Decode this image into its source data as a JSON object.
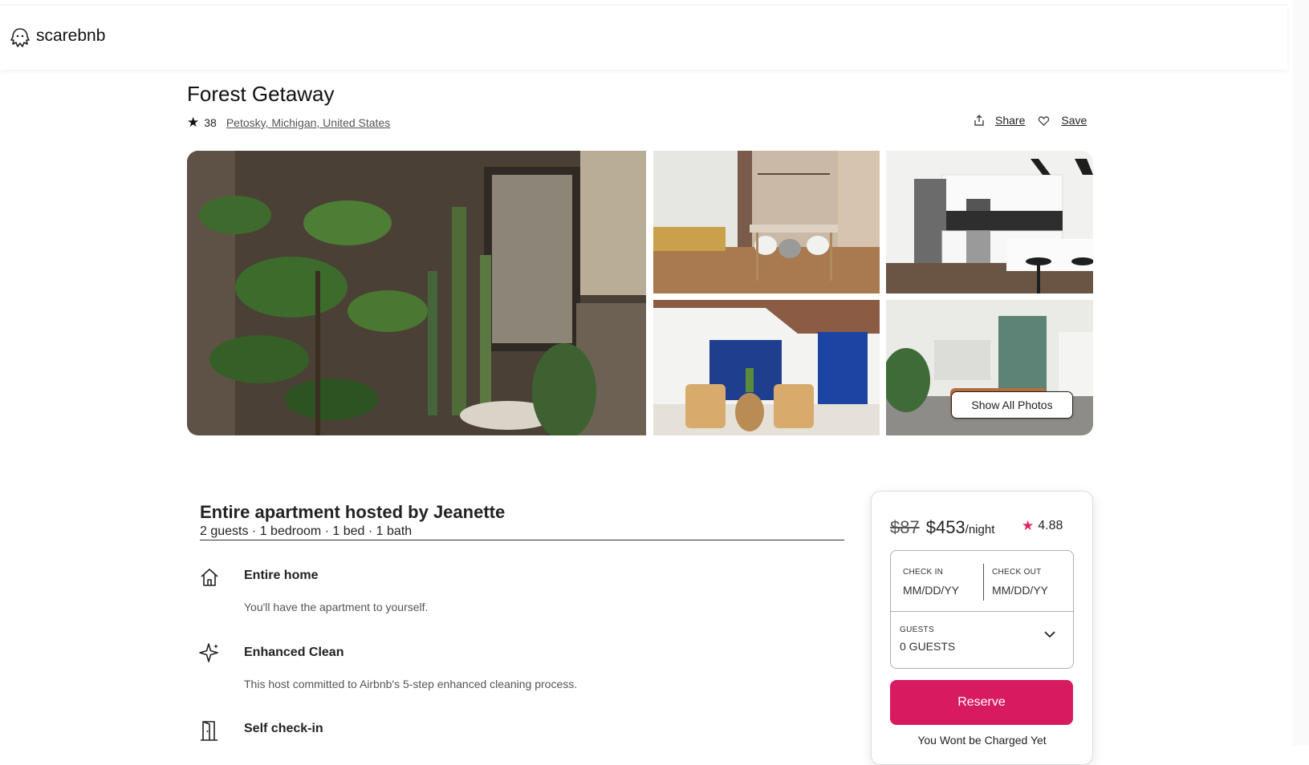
{
  "brand": {
    "name": "scarebnb",
    "icon": "ghost-icon"
  },
  "listing": {
    "title": "Forest Getaway",
    "review_count": "38",
    "location": "Petosky, Michigan, United States"
  },
  "actions": {
    "share_label": "Share",
    "save_label": "Save"
  },
  "gallery": {
    "show_all_label": "Show All Photos"
  },
  "host": {
    "title": "Entire apartment hosted by Jeanette",
    "summary": "2 guests · 1 bedroom · 1 bed · 1 bath"
  },
  "features": [
    {
      "icon": "home-icon",
      "title": "Entire home",
      "description": "You'll have the apartment to yourself."
    },
    {
      "icon": "sparkle-icon",
      "title": "Enhanced Clean",
      "description": "This host committed to Airbnb's 5-step enhanced cleaning process."
    },
    {
      "icon": "door-icon",
      "title": "Self check-in",
      "description": ""
    }
  ],
  "booking": {
    "old_price": "$87",
    "price": "$453",
    "per": "/night",
    "rating": "4.88",
    "check_in_label": "CHECK IN",
    "check_in_value": "MM/DD/YY",
    "check_out_label": "CHECK OUT",
    "check_out_value": "MM/DD/YY",
    "guests_label": "GUESTS",
    "guests_value": "0 GUESTS",
    "reserve_label": "Reserve",
    "note": "You Wont be Charged Yet"
  },
  "colors": {
    "accent": "#d81b60",
    "star_accent": "#e0245e",
    "text": "#222222"
  }
}
